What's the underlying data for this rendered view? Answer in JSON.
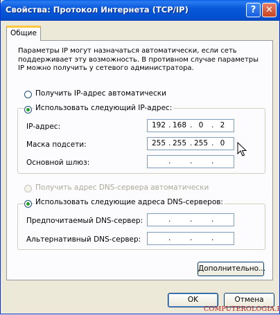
{
  "window": {
    "title": "Свойства: Протокол Интернета (TCP/IP)",
    "help_glyph": "?",
    "close_glyph": "✕"
  },
  "tabs": [
    {
      "label": "Общие",
      "active": true
    }
  ],
  "description": "Параметры IP могут назначаться автоматически, если сеть поддерживает эту возможность. В противном случае параметры IP можно получить у сетевого администратора.",
  "ip_section": {
    "auto_radio": {
      "label": "Получить IP-адрес автоматически",
      "checked": false
    },
    "manual_radio": {
      "label": "Использовать следующий IP-адрес:",
      "checked": true
    },
    "fields": [
      {
        "label": "IP-адрес:",
        "octets": [
          "192",
          "168",
          "0",
          "2"
        ]
      },
      {
        "label": "Маска подсети:",
        "octets": [
          "255",
          "255",
          "255",
          "0"
        ]
      },
      {
        "label": "Основной шлюз:",
        "octets": [
          "",
          "",
          "",
          ""
        ]
      }
    ]
  },
  "dns_section": {
    "auto_radio": {
      "label": "Получить адрес DNS-сервера автоматически",
      "checked": false,
      "disabled": true
    },
    "manual_radio": {
      "label": "Использовать следующие адреса DNS-серверов:",
      "checked": true
    },
    "fields": [
      {
        "label": "Предпочитаемый DNS-сервер:",
        "octets": [
          "",
          "",
          "",
          ""
        ]
      },
      {
        "label": "Альтернативный DNS-сервер:",
        "octets": [
          "",
          "",
          "",
          ""
        ]
      }
    ]
  },
  "buttons": {
    "advanced": "Дополнительно...",
    "ok": "OK",
    "cancel": "Отмена"
  },
  "watermark": "COMPUTEROLOGIA.RU",
  "colors": {
    "titlebar": "#0054e3",
    "radio_dot": "#21a121",
    "watermark": "#c01818"
  }
}
